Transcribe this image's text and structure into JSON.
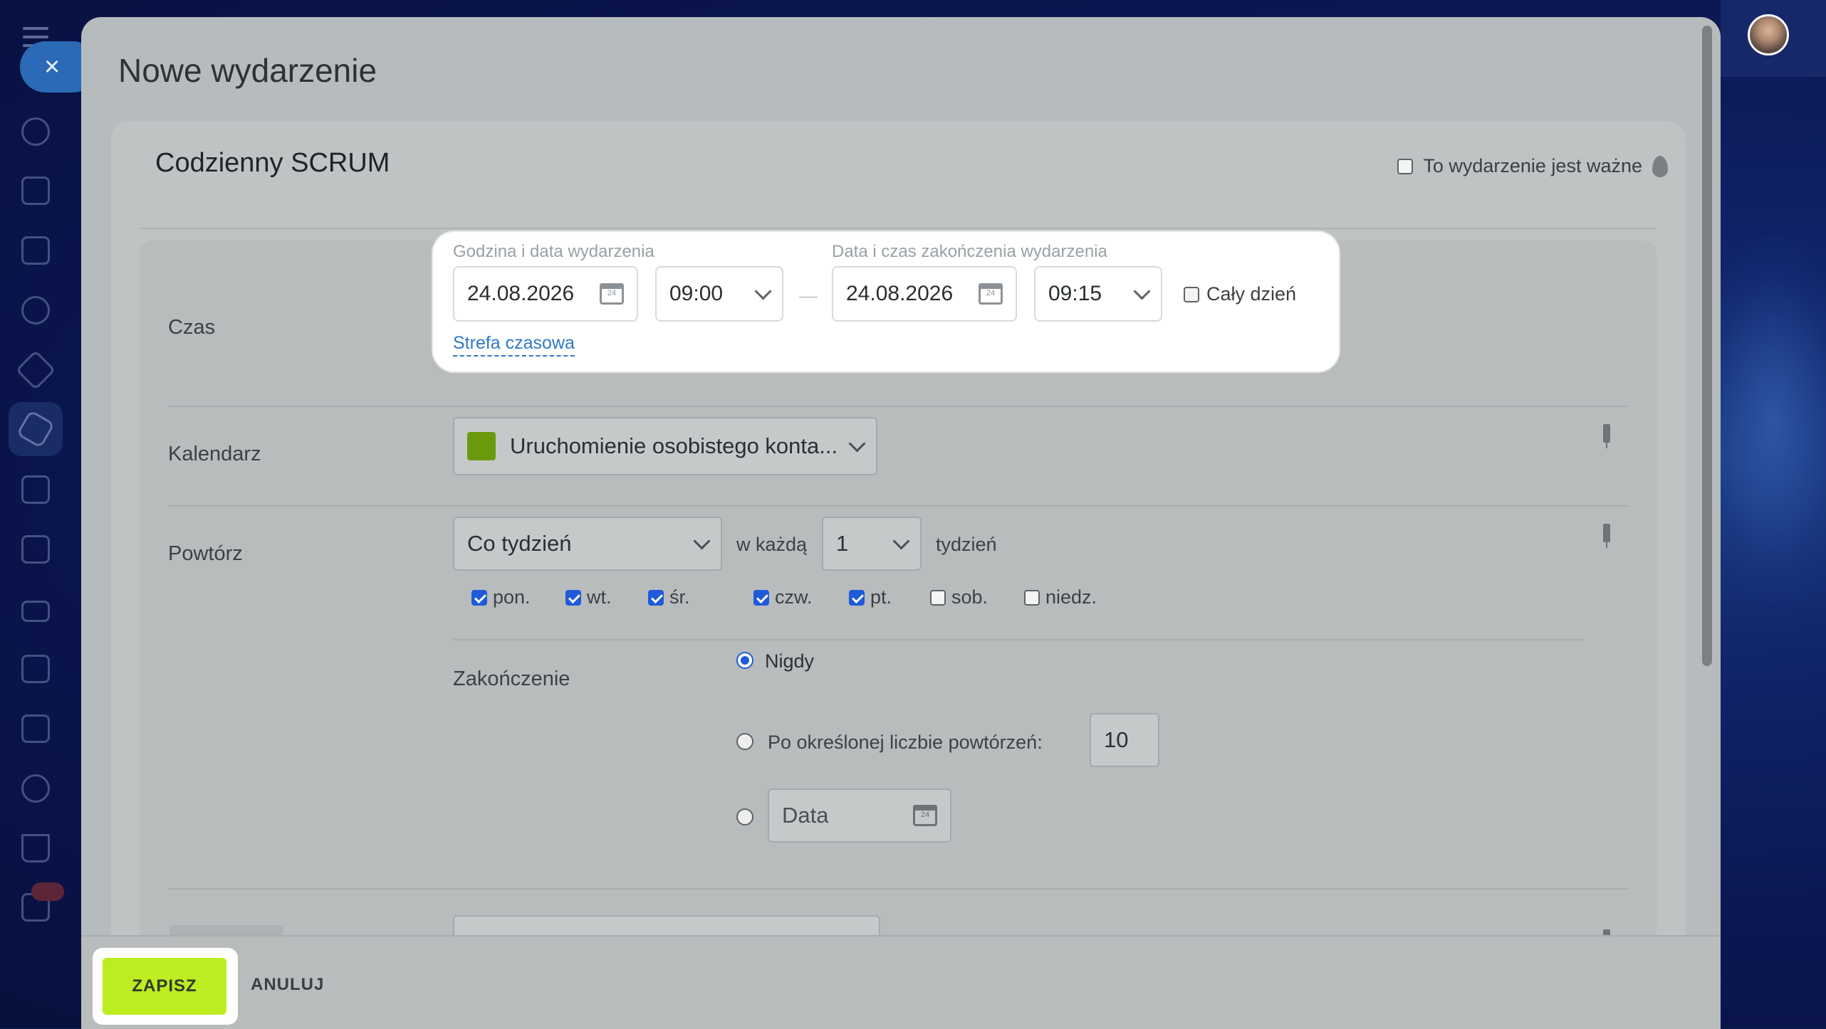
{
  "page": {
    "title": "Nowe wydarzenie"
  },
  "event": {
    "name": "Codzienny SCRUM",
    "important_label": "To wydarzenie jest ważne",
    "important_checked": false
  },
  "time": {
    "row_label": "Czas",
    "start_label": "Godzina i data wydarzenia",
    "start_date": "24.08.2026",
    "start_time": "09:00",
    "end_label": "Data i czas zakończenia wydarzenia",
    "end_date": "24.08.2026",
    "end_time": "09:15",
    "separator": "—",
    "all_day_label": "Cały dzień",
    "all_day_checked": false,
    "timezone_link": "Strefa czasowa",
    "calendar_day_glyph": "24"
  },
  "calendar": {
    "row_label": "Kalendarz",
    "selected": "Uruchomienie osobistego konta...",
    "color": "#6b9a0e"
  },
  "repeat": {
    "row_label": "Powtórz",
    "frequency": "Co tydzień",
    "every_label": "w każdą",
    "interval": "1",
    "unit_label": "tydzień",
    "weekdays": [
      {
        "label": "pon.",
        "checked": true
      },
      {
        "label": "wt.",
        "checked": true
      },
      {
        "label": "śr.",
        "checked": true
      },
      {
        "label": "czw.",
        "checked": true
      },
      {
        "label": "pt.",
        "checked": true
      },
      {
        "label": "sob.",
        "checked": false
      },
      {
        "label": "niedz.",
        "checked": false
      }
    ],
    "ending_label": "Zakończenie",
    "ending_options": {
      "never": "Nigdy",
      "after_count": "Po określonej liczbie powtórzeń:",
      "count_value": "10",
      "date_placeholder": "Data"
    },
    "ending_selected": "never"
  },
  "footer": {
    "save": "ZAPISZ",
    "cancel": "ANULUJ"
  },
  "colors": {
    "accent_blue": "#1f5bd8",
    "save_green": "#bbed21",
    "link_blue": "#2e79c8"
  }
}
